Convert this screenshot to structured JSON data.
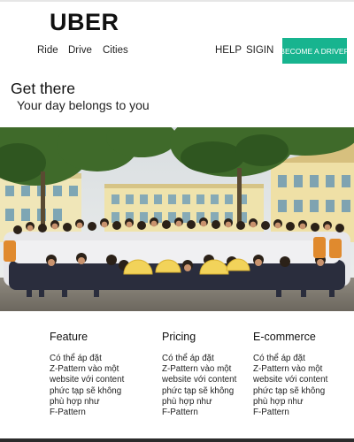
{
  "brand": {
    "logo": "UBER"
  },
  "nav": {
    "ride": "Ride",
    "drive": "Drive",
    "cities": "Cities",
    "help": "HELP",
    "sign": "SIGIN",
    "cta": "BECOME A DRIVER"
  },
  "colors": {
    "accent": "#17b48f",
    "text": "#111111",
    "background": "#ffffff"
  },
  "hero": {
    "title": "Get there",
    "subtitle": "Your day belongs to you",
    "image": "group-photo"
  },
  "features": [
    {
      "title": "Feature",
      "lines": [
        "Có thể áp đặt",
        "Z-Pattern vào một",
        "website với content",
        "phức tạp sẽ không",
        "phù hợp như",
        "F-Pattern"
      ]
    },
    {
      "title": "Pricing",
      "lines": [
        "Có thể áp đặt",
        "Z-Pattern vào một",
        "website với content",
        "phức tạp sẽ không",
        "phù hợp như",
        "F-Pattern"
      ]
    },
    {
      "title": "E-commerce",
      "lines": [
        "Có thể áp đặt",
        "Z-Pattern vào một",
        "website với content",
        "phức tạp sẽ không",
        "phù hợp như",
        "F-Pattern"
      ]
    }
  ]
}
